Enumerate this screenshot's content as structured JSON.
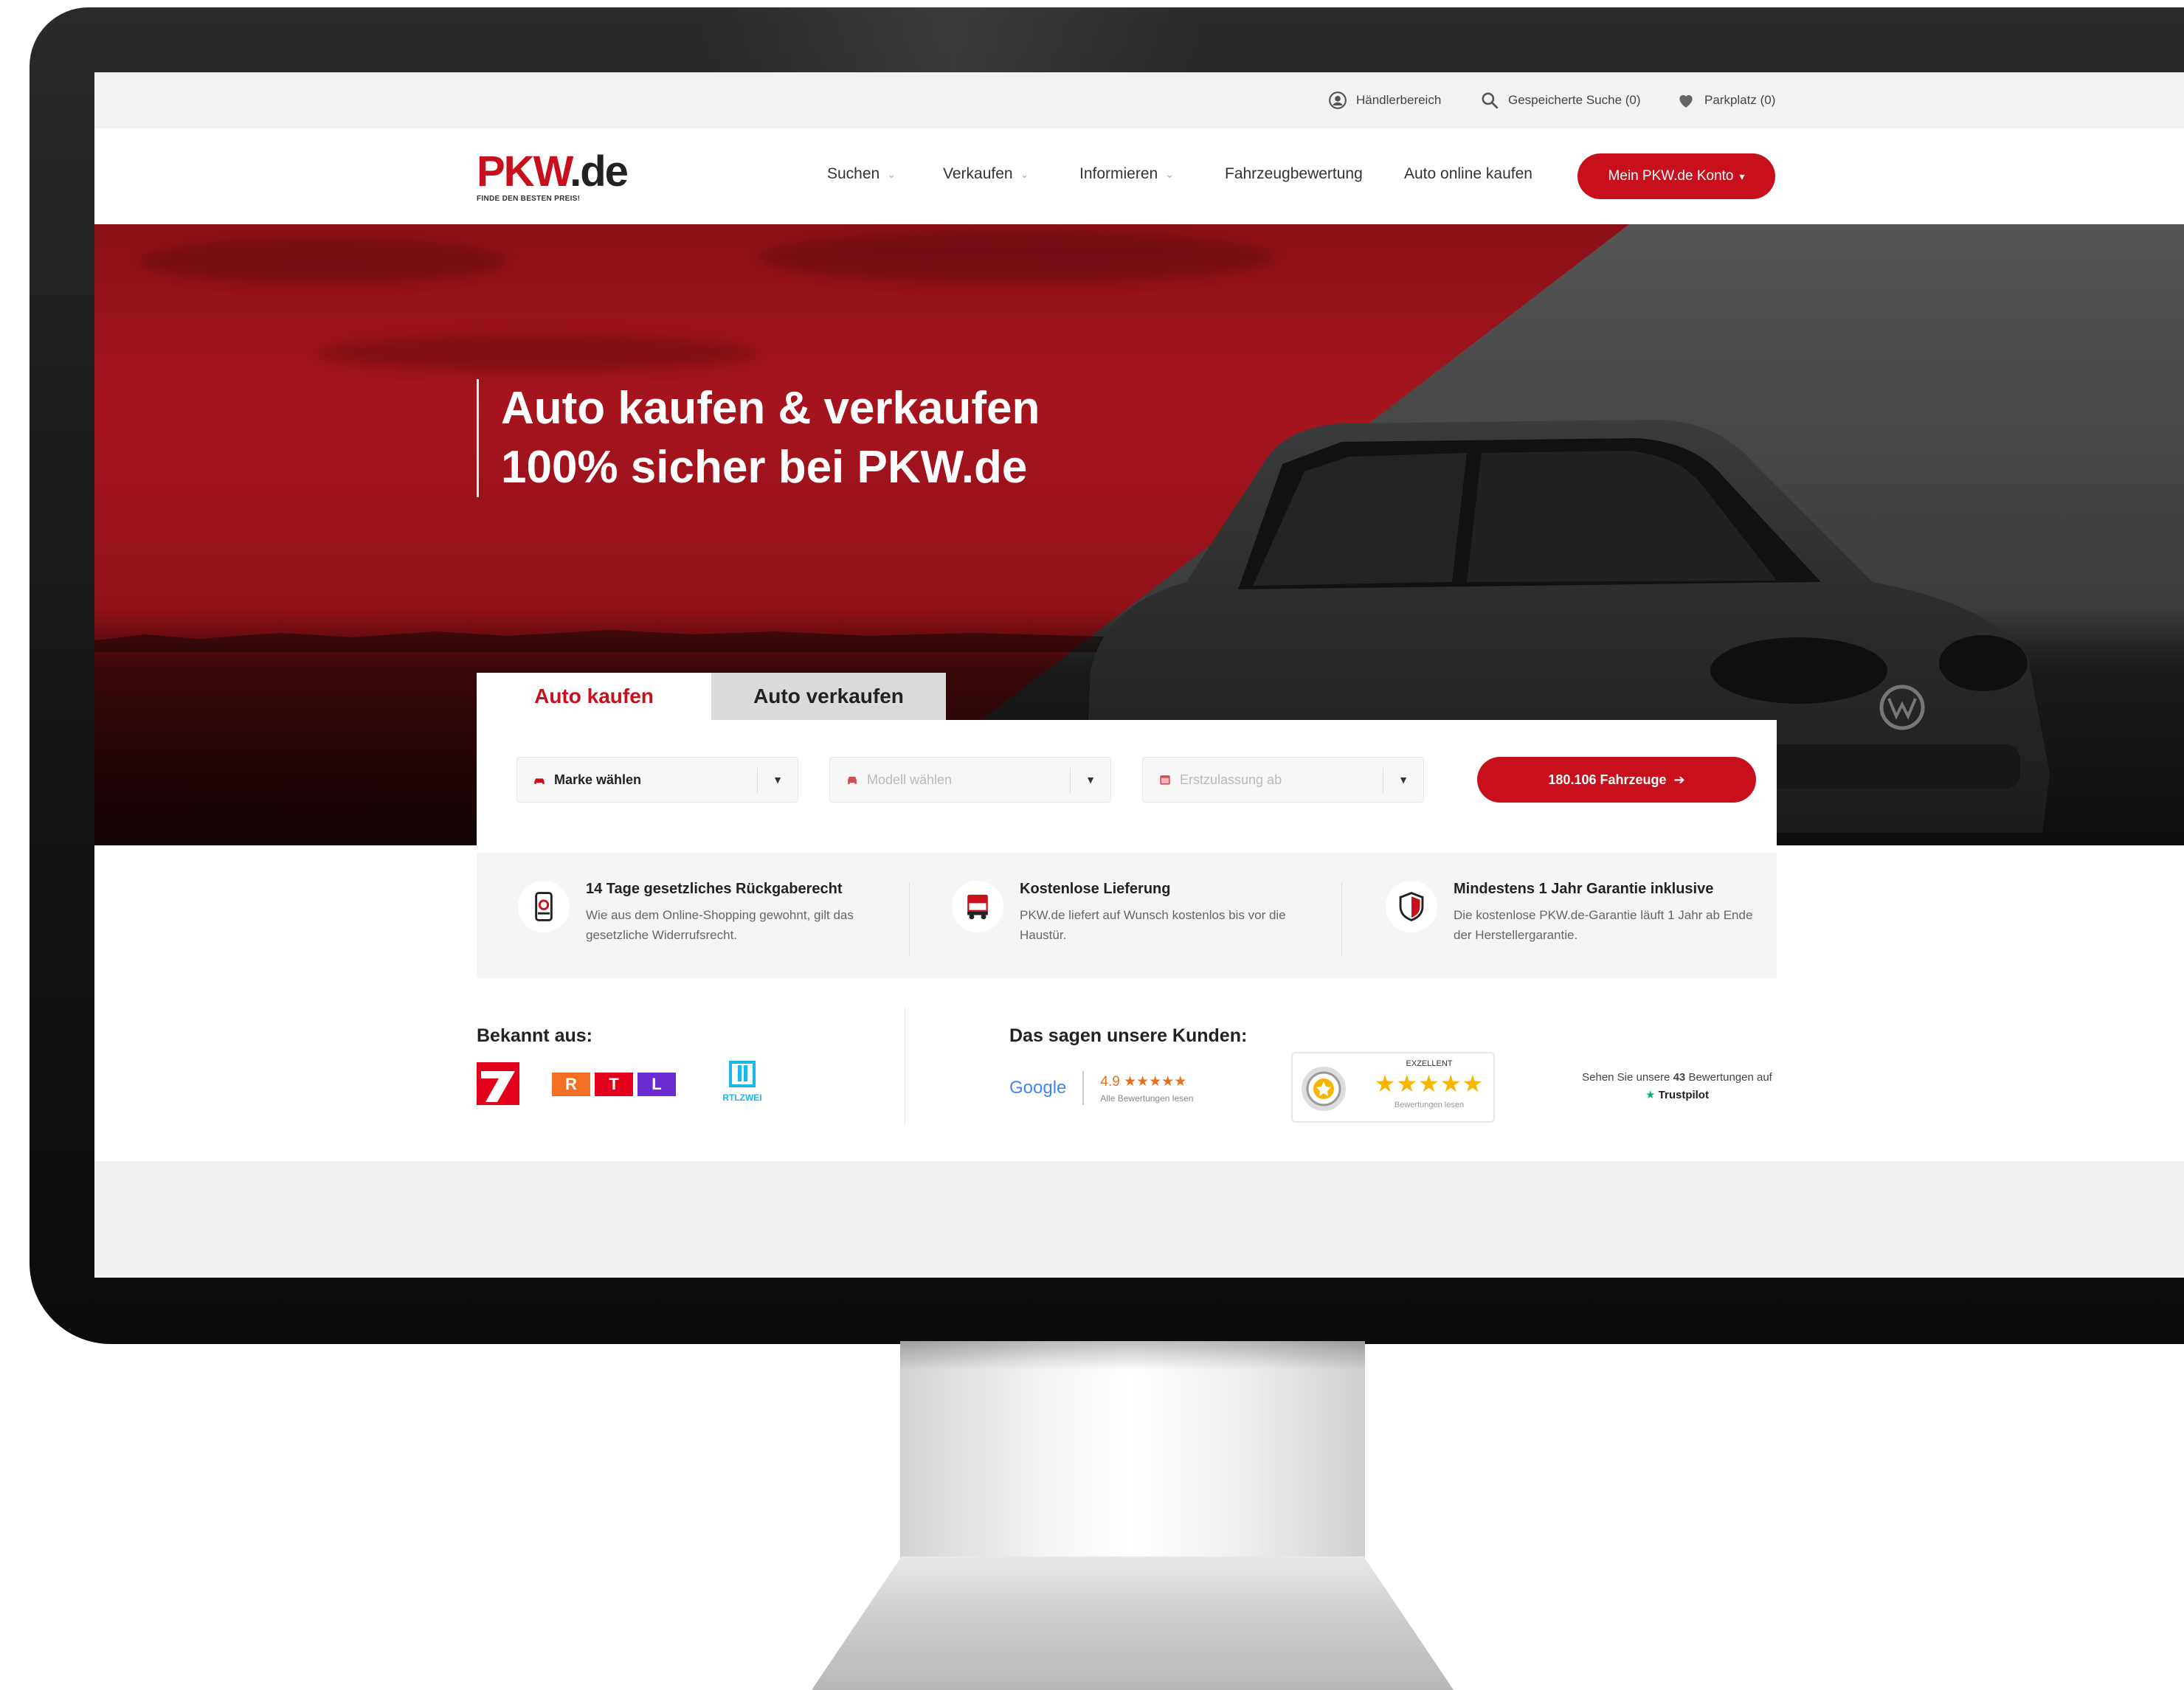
{
  "topbar": {
    "dealer": "Händlerbereich",
    "saved_search": "Gespeicherte Suche (0)",
    "parking": "Parkplatz (0)"
  },
  "logo": {
    "brand_red": "PKW",
    "brand_dark": ".de",
    "tagline": "FINDE DEN BESTEN PREIS!"
  },
  "nav": {
    "items": [
      {
        "label": "Suchen",
        "dropdown": true
      },
      {
        "label": "Verkaufen",
        "dropdown": true
      },
      {
        "label": "Informieren",
        "dropdown": true
      },
      {
        "label": "Fahrzeugbewertung",
        "dropdown": false
      },
      {
        "label": "Auto online kaufen",
        "dropdown": false
      }
    ],
    "account_button": "Mein PKW.de Konto"
  },
  "hero": {
    "line1": "Auto kaufen & verkaufen",
    "line2": "100% sicher bei PKW.de"
  },
  "search": {
    "tabs": [
      "Auto kaufen",
      "Auto verkaufen"
    ],
    "make_select": "Marke wählen",
    "model_select": "Modell wählen",
    "registration_select": "Erstzulassung ab",
    "submit": "180.106 Fahrzeuge"
  },
  "usps": [
    {
      "title": "14 Tage gesetzliches Rückgaberecht",
      "text": "Wie aus dem Online-Shopping gewohnt, gilt das gesetzliche Widerrufsrecht."
    },
    {
      "title": "Kostenlose Lieferung",
      "text": "PKW.de liefert auf Wunsch kostenlos bis vor die Haustür."
    },
    {
      "title": "Mindestens 1 Jahr Garantie inklusive",
      "text": "Die kostenlose PKW.de-Garantie läuft 1 Jahr ab Ende der Herstellergarantie."
    }
  ],
  "press": {
    "title": "Bekannt aus:",
    "rtl_letters": [
      "R",
      "T",
      "L"
    ],
    "rtl2": "RTLZWEI"
  },
  "reviews": {
    "title": "Das sagen unsere Kunden:",
    "google": "Google",
    "google_rating": "4.9",
    "google_stars": "★★★★★",
    "google_sub": "Alle Bewertungen lesen",
    "badge_label": "EXZELLENT",
    "badge_stars": "★★★★★",
    "badge_sub": "Bewertungen lesen",
    "trustpilot_prefix": "Sehen Sie unsere",
    "trustpilot_count": "43",
    "trustpilot_suffix": "Bewertungen auf",
    "trustpilot": "Trustpilot"
  },
  "colors": {
    "brand_red": "#c8101c",
    "dark": "#222222",
    "trustpilot_green": "#00b67a",
    "star_orange": "#e7711b"
  }
}
